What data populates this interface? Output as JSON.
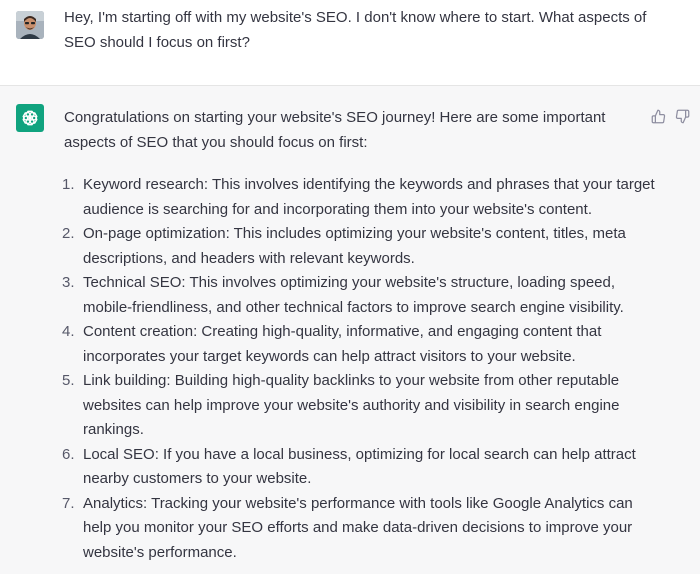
{
  "user_message": {
    "text": "Hey, I'm starting off with my website's SEO. I don't know where to start. What aspects of SEO should I focus on first?"
  },
  "assistant_message": {
    "intro": "Congratulations on starting your website's SEO journey! Here are some important aspects of SEO that you should focus on first:",
    "items": [
      {
        "number": "1.",
        "text": "Keyword research: This involves identifying the keywords and phrases that your target audience is searching for and incorporating them into your website's content."
      },
      {
        "number": "2.",
        "text": "On-page optimization: This includes optimizing your website's content, titles, meta descriptions, and headers with relevant keywords."
      },
      {
        "number": "3.",
        "text": "Technical SEO: This involves optimizing your website's structure, loading speed, mobile-friendliness, and other technical factors to improve search engine visibility."
      },
      {
        "number": "4.",
        "text": "Content creation: Creating high-quality, informative, and engaging content that incorporates your target keywords can help attract visitors to your website."
      },
      {
        "number": "5.",
        "text": "Link building: Building high-quality backlinks to your website from other reputable websites can help improve your website's authority and visibility in search engine rankings."
      },
      {
        "number": "6.",
        "text": "Local SEO: If you have a local business, optimizing for local search can help attract nearby customers to your website."
      },
      {
        "number": "7.",
        "text": "Analytics: Tracking your website's performance with tools like Google Analytics can help you monitor your SEO efforts and make data-driven decisions to improve your website's performance."
      }
    ]
  },
  "icons": {
    "assistant_avatar": "openai-logo-icon",
    "thumbs_up": "thumbs-up-icon",
    "thumbs_down": "thumbs-down-icon"
  },
  "colors": {
    "assistant_bg": "#f7f7f8",
    "assistant_avatar_bg": "#10a37f",
    "text": "#343541"
  }
}
